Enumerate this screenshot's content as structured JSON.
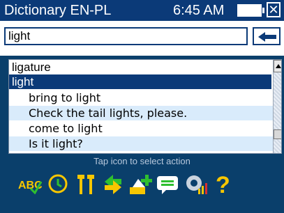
{
  "titlebar": {
    "title": "Dictionary EN-PL",
    "time": "6:45 AM"
  },
  "search": {
    "value": "light"
  },
  "list": {
    "items": [
      {
        "text": "ligature",
        "type": "headword"
      },
      {
        "text": "light",
        "type": "headword",
        "selected": true
      },
      {
        "text": "bring to light",
        "type": "phrase"
      },
      {
        "text": "Check the tail lights, please.",
        "type": "phrase"
      },
      {
        "text": "come to light",
        "type": "phrase"
      },
      {
        "text": "Is it light?",
        "type": "phrase"
      }
    ]
  },
  "actionbar": {
    "hint": "Tap icon to select action",
    "icons": [
      "spellcheck-icon",
      "history-icon",
      "tools-icon",
      "swap-icon",
      "add-entry-icon",
      "comment-icon",
      "speech-icon",
      "help-icon"
    ]
  },
  "colors": {
    "titlebar_bg": "#0b3a78",
    "selection_bg": "#0b3a78",
    "alt_row_bg": "#d9ebfb",
    "actionbar_bg": "#0a3f6b",
    "icon_yellow": "#f7c600",
    "icon_green": "#2fbf2f"
  }
}
